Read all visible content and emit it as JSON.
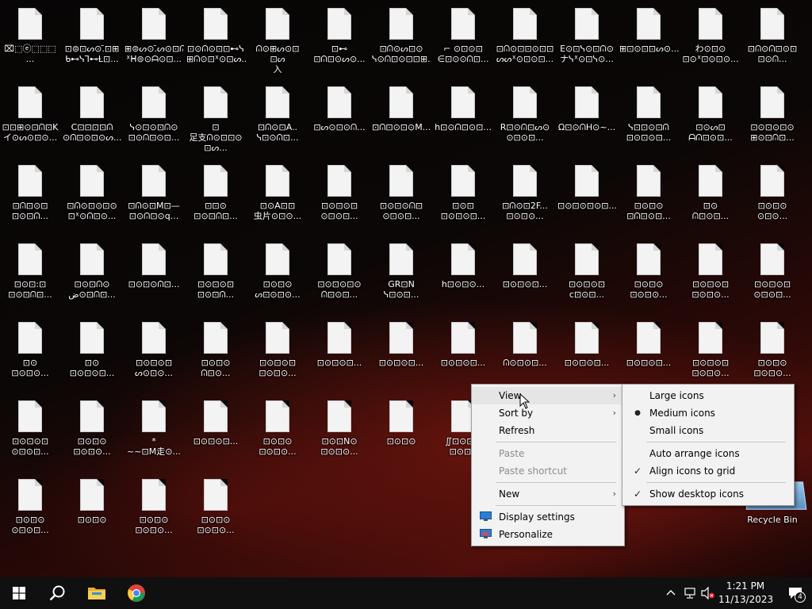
{
  "desktop": {
    "icons": [
      {
        "label": "⌧⬚ⓔ⬚⬚⬚ ..."
      },
      {
        "label": "⊡⊜⊡ᔕ⊙.̄⊡⊞\nᑲ⊷ᓭ⅂⊷Ɫ⊡..."
      },
      {
        "label": "⊞⊜ᔕ⊙.̄ᔕ⊙⊡ᕬ\nᕽᕼ⊜⊙ᗩ⊙⊡..."
      },
      {
        "label": "⊡⊙ᕬ⊙⊡⊡⊷ᓭ\n⊞ᕬ⊙⊡ᕽ⊙⊡ᔕ..."
      },
      {
        "label": "ᕬ⊙⊞ᔕ⊙⊡ ⊡ᔕ\n入⊙⊡⊞⊡⊡⊞..."
      },
      {
        "label": "⊡⊷ ⊡ᕬ⊡⊙ᔕ⊙..."
      },
      {
        "label": "⊡ᕬ⊙ᔕ⊡⊙\nᓭ⊙ᕬ⊡⊙⊡⊡⊞..."
      },
      {
        "label": "⌐ ⊙⊡⊙⊡\n∈⊡⊙⊙ᕬ⊡..."
      },
      {
        "label": "⊡ᕬ⊙⊡⊡⊙⊡⊡\nᔕᔕᕽ⊙⊡⊙⊡..."
      },
      {
        "label": "E⊙⊡ᓭ⊙⊡ᕬ⊙\nナᓭᕽ⊙⊡ᓭ⊙..."
      },
      {
        "label": "⊞⊡⊙⊡⊡ᔕ⊙..."
      },
      {
        "label": "わ⊙⊡⊙\n⊡⊙ᕽ⊡⊙⊡⊙..."
      },
      {
        "label": "⊡ᕬ⊙ᕬ⊡⊙⊡\n⊡⊙ᕬ..."
      },
      {
        "label": "⊡⊡⊞⊙⊡ᕬ⊡K\nイ⊙ᔕ⊙⊡⊙..."
      },
      {
        "label": "C⊡⊡⊡⊡ᕬ\n⊙ᕬ⊡⊙⊡⊙ᔕ..."
      },
      {
        "label": "ᓭ⊙⊡⊙⊡ᕬ⊙\n⊡⊙ᕬ⊡⊙⊡..."
      },
      {
        "label": "⊡\n足支ᕬ⊙⊡⊡⊙\n⊡ᔕ..."
      },
      {
        "label": "⊡ᕬ⊙⊡A..\nᓭ⊡⊙ᕬ⊡..."
      },
      {
        "label": "⊡ᔕ⊙⊡⊙ᕬ..."
      },
      {
        "label": "⊡ᕬ⊡⊙⊡⊙M..."
      },
      {
        "label": "h⊡⊙ᕬ⊡⊙⊡..."
      },
      {
        "label": "R⊡⊙ᕬ⊡ᔕ⊙\n⊙⊡⊙⊡..."
      },
      {
        "label": "Ω⊡⊙ᕬH⊙~..."
      },
      {
        "label": "ᓭ⊡⊡⊙⊡ᕬ\n⊡⊙⊡⊙⊡..."
      },
      {
        "label": "⊡⊙ᔕ⊡\nᗩᕬ⊡⊙⊡..."
      },
      {
        "label": "⊡⊙⊡⊙⊡⊙\n⊞⊙⊡ᕬ⊡..."
      },
      {
        "label": "⊡ᕬ⊡⊙⊡\n⊡⊙⊡ᕬ..."
      },
      {
        "label": "⊡ᕬ⊙⊡⊙⊡⊙\n⊡ᕽ⊙ᕬ⊡⊙..."
      },
      {
        "label": "⊡ᕬ⊙⊡M⊡—\n⊡⊙ᕬ⊡⊙q..."
      },
      {
        "label": "⊡⊡⊙\n⊡⊙⊡ᕬ⊡..."
      },
      {
        "label": "⊡⊙A⊡⊡\n虫片⊙⊡⊙..."
      },
      {
        "label": "⊡⊙⊡⊙⊡\n⊙⊡⊙⊡..."
      },
      {
        "label": "⊡⊙⊡⊙ᕬ⊡\n⊙⊡⊙⊡..."
      },
      {
        "label": "⊡⊙⊡\n⊡⊙⊡⊙⊡..."
      },
      {
        "label": "⊡ᕬ⊙⊡2F...\n⊡⊙⊡⊙..."
      },
      {
        "label": "⊡⊙⊡⊙⊡⊙⊡..."
      },
      {
        "label": "⊡⊙⊡⊙\n⊡ᕬ⊡⊙⊡..."
      },
      {
        "label": "⊡⊙\nᕬ⊡⊙⊡..."
      },
      {
        "label": "⊡⊙⊡⊙\n⊙⊡⊙..."
      },
      {
        "label": "⊡⊙⊡:⊡\n⊡⊙⊡ᕬ⊡..."
      },
      {
        "label": "⊡⊙⊡ᕬ⊙\nض⊙⊡ᕬ⊡..."
      },
      {
        "label": "⊡⊙⊡⊙ᕬ⊡..."
      },
      {
        "label": "⊡⊙⊡⊙⊡\n⊡⊙⊡ᕬ..."
      },
      {
        "label": "⊡⊙⊡⊙\nᔕ⊡⊙⊡⊙..."
      },
      {
        "label": "⊡⊙⊡⊙⊡⊙\nᕬ⊡⊙⊡..."
      },
      {
        "label": "GR⊡N\nᓭ⊡⊙⊡..."
      },
      {
        "label": "h⊡⊙⊡⊙..."
      },
      {
        "label": "⊡⊙⊡⊙⊡..."
      },
      {
        "label": "⊡⊙⊡⊙⊡\nc⊡⊙⊡..."
      },
      {
        "label": "⊡⊙⊡⊙\n⊡⊙⊡⊙..."
      },
      {
        "label": "⊡⊙⊡⊙⊡\n⊡⊙⊡⊙..."
      },
      {
        "label": "⊡⊙⊡⊙⊡\n⊙⊡⊙⊡..."
      },
      {
        "label": "⊡⊙\n⊡⊙⊡⊙..."
      },
      {
        "label": "⊡⊙\n⊡⊙⊡⊙⊡..."
      },
      {
        "label": "⊡⊙⊡⊙⊡\nᔕ⊙⊡⊙..."
      },
      {
        "label": "⊡⊙⊡⊙\nᕬ⊡⊙..."
      },
      {
        "label": "⊡⊙⊡⊙⊡\n⊡⊙⊡⊙..."
      },
      {
        "label": "⊡⊙⊡⊙⊡..."
      },
      {
        "label": "⊡⊙⊡⊙⊡..."
      },
      {
        "label": "⊡⊙⊡⊙⊡..."
      },
      {
        "label": "ᕬ⊙⊡⊙⊡..."
      },
      {
        "label": "⊡⊙⊡⊙⊡..."
      },
      {
        "label": "⊡⊙⊡⊙⊡..."
      },
      {
        "label": "⊡⊙⊡⊙⊡\n⊡⊙⊡⊙..."
      },
      {
        "label": "⊡⊙⊡⊙\n⊡⊙⊡⊙..."
      },
      {
        "label": "⊡⊙⊡⊙⊡\n⊙⊡⊙⊡..."
      },
      {
        "label": "⊡⊙⊡⊙\n⊡⊙⊡⊙..."
      },
      {
        "label": "*\n~~⊡M走⊙..."
      },
      {
        "label": "⊡⊙⊡⊙⊡..."
      },
      {
        "label": "⊡⊙⊡⊙\n⊡⊙⊡⊙..."
      },
      {
        "label": "⊡⊙⊡N⊙\n⊡⊙⊡⊙..."
      },
      {
        "label": "⊡⊙⊡⊙"
      },
      {
        "label": "∬⊡⊙⊡⊙\n⊡⊙⊡K"
      },
      {
        "label": "⊡⊙⊡⊙⊡\n⊡⊙⊡⊙..."
      },
      {
        "label": "⊡⊙⊡⊙\n⊙⊡⊙⊡..."
      },
      {
        "label": "⊡⊙⊡⊙\n⊡⊙⊡⊙..."
      },
      {
        "label": "⊡⊙⊡⊙\n⊡⊙⊡⊙..."
      },
      {
        "label": "⊡⊙⊡⊙\n⊡⊙⊡⊙..."
      },
      {
        "label": "⊡⊙⊡⊙\n⊙⊡⊙⊡..."
      },
      {
        "label": "⊡⊙⊡⊙"
      },
      {
        "label": "⊡⊙⊡⊙\n⊡⊙⊡⊙..."
      },
      {
        "label": "⊡⊙⊡⊙\n⊡⊙⊡⊙..."
      },
      {
        "label": "Recycle Bin"
      }
    ]
  },
  "context_menu": {
    "items": [
      {
        "label": "View",
        "arrow": "›"
      },
      {
        "label": "Sort by",
        "arrow": "›"
      },
      {
        "label": "Refresh"
      },
      {
        "label": "Paste"
      },
      {
        "label": "Paste shortcut"
      },
      {
        "label": "New",
        "arrow": "›"
      },
      {
        "label": "Display settings"
      },
      {
        "label": "Personalize"
      }
    ]
  },
  "view_submenu": {
    "items": [
      {
        "label": "Large icons",
        "mark": ""
      },
      {
        "label": "Medium icons",
        "mark": "●"
      },
      {
        "label": "Small icons",
        "mark": ""
      },
      {
        "label": "Auto arrange icons",
        "mark": ""
      },
      {
        "label": "Align icons to grid",
        "mark": "✓"
      },
      {
        "label": "Show desktop icons",
        "mark": "✓"
      }
    ]
  },
  "taskbar": {
    "clock_time": "1:21 PM",
    "clock_date": "11/13/2023",
    "notification_count": "4",
    "icons": [
      "windows-start-icon",
      "search-icon",
      "file-explorer-icon",
      "chrome-icon"
    ],
    "tray_icons": [
      "chevron-up-icon",
      "network-icon",
      "volume-muted-icon"
    ]
  },
  "colors": {
    "menu_bg": "#f2f2f2",
    "menu_highlight": "#e5e5e5",
    "taskbar": "#101010"
  }
}
